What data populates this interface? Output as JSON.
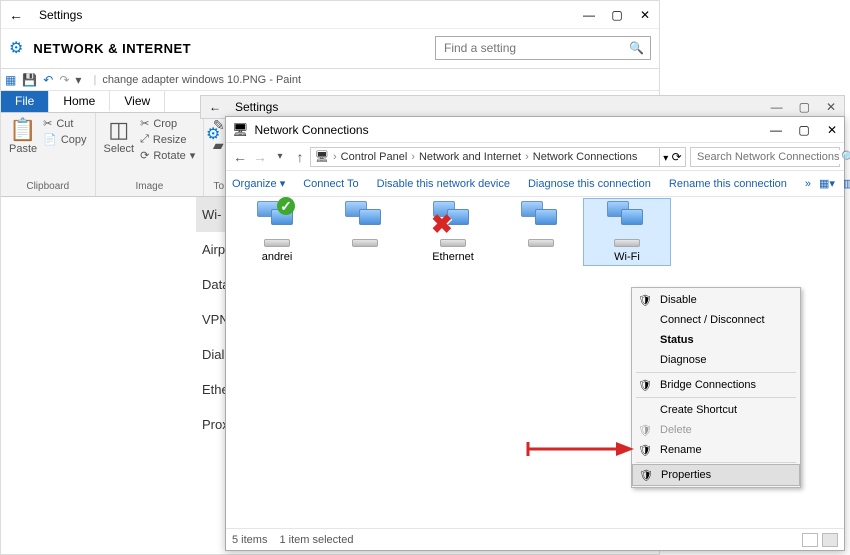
{
  "settings": {
    "title": "Settings",
    "header": "NETWORK & INTERNET",
    "search_placeholder": "Find a setting",
    "sidebar": [
      "Wi-Fi",
      "Airplane mode",
      "Data usage",
      "VPN",
      "Dial-up",
      "Ethernet",
      "Proxy"
    ],
    "sidebar_selected": 0
  },
  "paint": {
    "qat_title": "change adapter windows 10.PNG - Paint",
    "tabs": [
      "File",
      "Home",
      "View"
    ],
    "ribbon": {
      "clipboard": {
        "paste": "Paste",
        "cut": "Cut",
        "copy": "Copy",
        "label": "Clipboard"
      },
      "image": {
        "select": "Select",
        "crop": "Crop",
        "resize": "Resize",
        "rotate": "Rotate",
        "label": "Image"
      },
      "tools_label": "To"
    },
    "ghost_sidebar": [
      "Wi-",
      "Airp",
      "Data",
      "VPN",
      "Dial",
      "Ethe",
      "Prox"
    ],
    "ghost_sidebar_selected": 0
  },
  "ghost_settings_title": "Settings",
  "explorer": {
    "title": "Network Connections",
    "breadcrumb": [
      "Control Panel",
      "Network and Internet",
      "Network Connections"
    ],
    "search_placeholder": "Search Network Connections",
    "toolbar": {
      "organize": "Organize",
      "connect": "Connect To",
      "disable": "Disable this network device",
      "diagnose": "Diagnose this connection",
      "rename": "Rename this connection"
    },
    "items": [
      {
        "label": "andrei",
        "status": "ok"
      },
      {
        "label": "",
        "status": "none"
      },
      {
        "label": "Ethernet",
        "status": "error"
      },
      {
        "label": "",
        "status": "none"
      },
      {
        "label": "Wi-Fi",
        "status": "none",
        "selected": true
      }
    ],
    "context_menu": [
      {
        "label": "Disable",
        "shield": true
      },
      {
        "label": "Connect / Disconnect"
      },
      {
        "label": "Status",
        "bold": true
      },
      {
        "label": "Diagnose"
      },
      {
        "sep": true
      },
      {
        "label": "Bridge Connections",
        "shield": true
      },
      {
        "sep": true
      },
      {
        "label": "Create Shortcut"
      },
      {
        "label": "Delete",
        "shield": true,
        "disabled": true
      },
      {
        "label": "Rename",
        "shield": true
      },
      {
        "sep": true
      },
      {
        "label": "Properties",
        "shield": true,
        "highlighted": true
      }
    ],
    "status": {
      "count": "5 items",
      "selected": "1 item selected"
    }
  }
}
